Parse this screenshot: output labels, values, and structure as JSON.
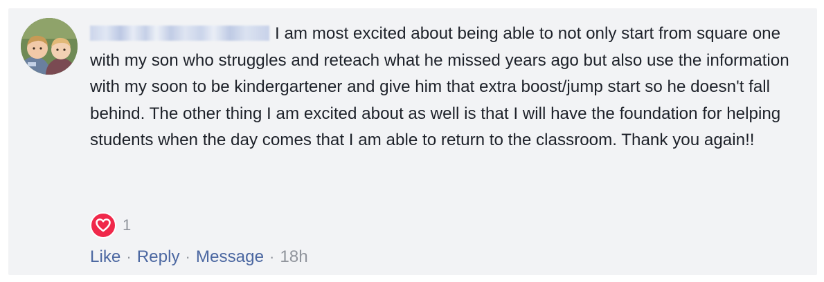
{
  "comment": {
    "author_name": "",
    "text": "I am most excited about being able to not only start from square one with my son who struggles and reteach what he missed years ago but also use the information with my soon to be kindergartener and give him that extra boost/jump start so he doesn't fall behind. The other thing I am excited about as well is that I will have the foundation for helping students when the day comes that I am able to return to the classroom. Thank you again!!",
    "reaction_icon": "heart-icon",
    "reaction_count": "1",
    "actions": {
      "like": "Like",
      "reply": "Reply",
      "message": "Message",
      "separator": "·",
      "timestamp": "18h"
    }
  },
  "colors": {
    "card_background": "#f2f3f5",
    "text": "#1d2129",
    "link": "#4b67a1",
    "muted": "#90949c",
    "heart": "#f0284a"
  }
}
